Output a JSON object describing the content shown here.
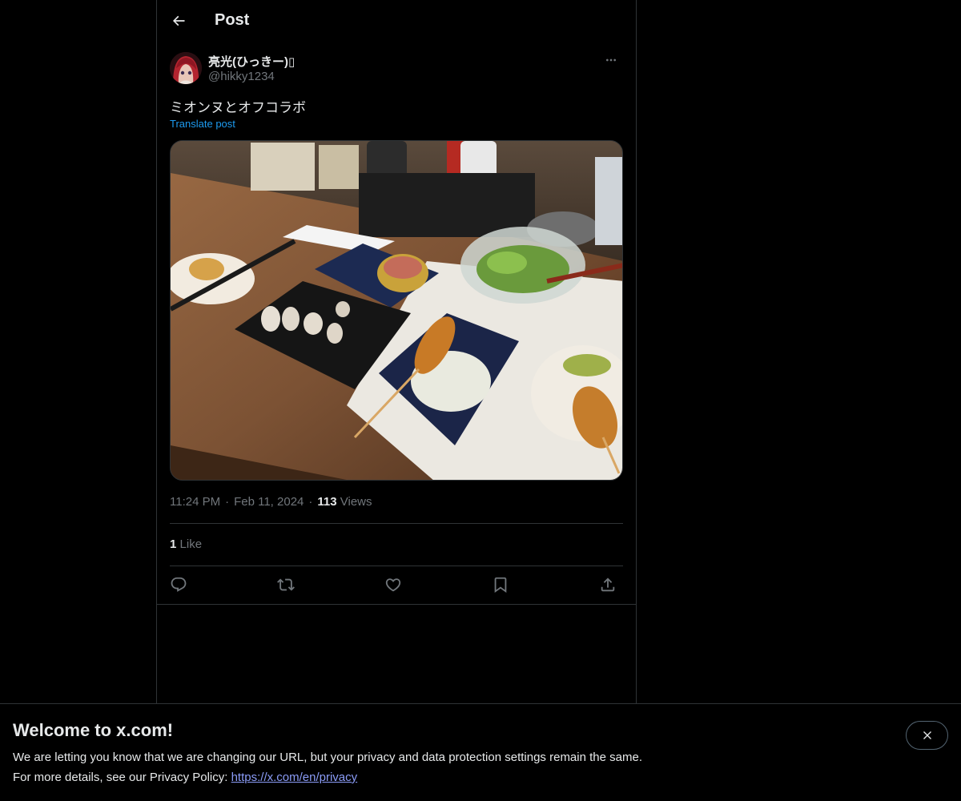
{
  "header": {
    "title": "Post",
    "back_icon": "arrow-left-icon"
  },
  "post": {
    "author": {
      "display_name": "亮光(ひっきー)▯",
      "handle": "@hikky1234",
      "avatar_icon": "avatar-image"
    },
    "more_icon": "more-horizontal-icon",
    "text": "ミオンヌとオフコラボ",
    "translate_label": "Translate post",
    "media": {
      "alt": "photo-of-food-on-table"
    },
    "meta": {
      "time": "11:24 PM",
      "separator": "·",
      "date": "Feb 11, 2024",
      "views_count": "113",
      "views_label": "Views"
    },
    "likes": {
      "count": "1",
      "label": "Like"
    },
    "actions": {
      "reply_icon": "reply-icon",
      "repost_icon": "repost-icon",
      "like_icon": "heart-icon",
      "bookmark_icon": "bookmark-icon",
      "share_icon": "share-icon"
    }
  },
  "banner": {
    "title": "Welcome to x.com!",
    "line1": "We are letting you know that we are changing our URL, but your privacy and data protection settings remain the same.",
    "line2_prefix": "For more details, see our Privacy Policy: ",
    "link": "https://x.com/en/privacy",
    "close_icon": "close-icon"
  },
  "colors": {
    "background": "#000000",
    "text": "#e7e9ea",
    "secondary": "#71767b",
    "accent": "#1d9bf0",
    "border": "#2f3336",
    "link": "#8b9cf7"
  }
}
